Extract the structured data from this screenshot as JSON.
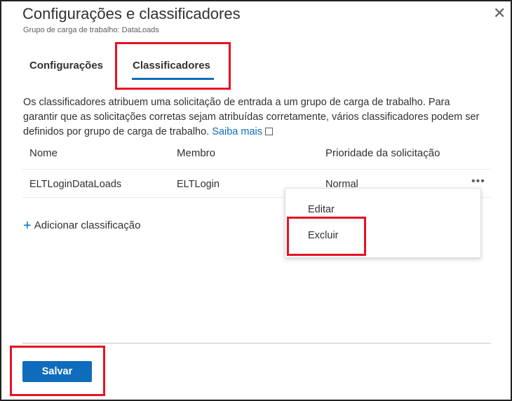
{
  "header": {
    "title": "Configurações e classificadores",
    "subtitle": "Grupo de carga de trabalho: DataLoads",
    "close_icon": "close-icon"
  },
  "tabs": [
    {
      "label": "Configurações",
      "selected": false
    },
    {
      "label": "Classificadores",
      "selected": true
    }
  ],
  "description": {
    "text": "Os classificadores atribuem uma solicitação de entrada a um grupo de carga de trabalho. Para garantir que as solicitações corretas sejam atribuídas corretamente, vários classificadores podem ser definidos por grupo de carga de trabalho.",
    "link": "Saiba mais",
    "link_icon": "external-link-icon"
  },
  "table": {
    "columns": [
      "Nome",
      "Membro",
      "Prioridade da solicitação"
    ],
    "rows": [
      {
        "name": "ELTLoginDataLoads",
        "member": "ELTLogin",
        "priority": "Normal"
      }
    ]
  },
  "add_label": "Adicionar classificação",
  "context_menu": {
    "items": [
      "Editar",
      "Excluir"
    ]
  },
  "save_label": "Salvar",
  "colors": {
    "accent": "#0f6cbd",
    "highlight": "#e81123"
  }
}
